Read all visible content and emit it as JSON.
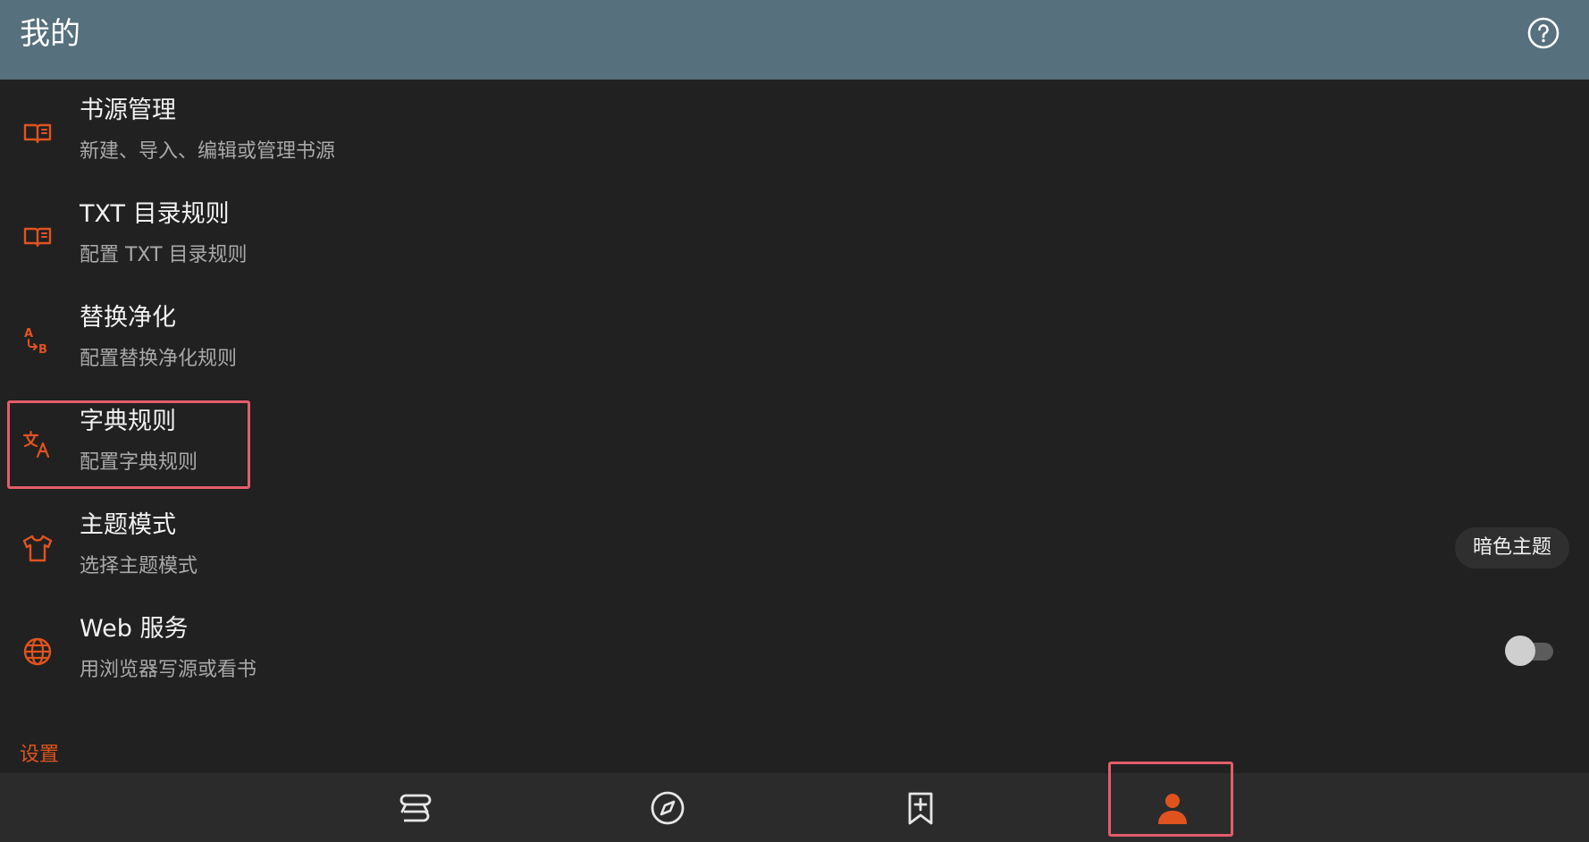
{
  "appbar": {
    "title": "我的",
    "help_icon": "help-circle-icon"
  },
  "menu": [
    {
      "title": "书源管理",
      "subtitle": "新建、导入、编辑或管理书源",
      "icon": "book-open-icon"
    },
    {
      "title": "TXT 目录规则",
      "subtitle": "配置 TXT 目录规则",
      "icon": "book-open-icon"
    },
    {
      "title": "替换净化",
      "subtitle": "配置替换净化规则",
      "icon": "a-to-b-replace-icon"
    },
    {
      "title": "字典规则",
      "subtitle": "配置字典规则",
      "icon": "translate-icon"
    },
    {
      "title": "主题模式",
      "subtitle": "选择主题模式",
      "icon": "tshirt-icon"
    },
    {
      "title": "Web 服务",
      "subtitle": "用浏览器写源或看书",
      "icon": "globe-icon"
    }
  ],
  "theme_chip": {
    "label": "暗色主题"
  },
  "web_service_switch": {
    "on": false
  },
  "section_settings": "设置",
  "bottom_nav": [
    {
      "name": "bookshelf",
      "icon": "bookshelf-icon",
      "active": false
    },
    {
      "name": "discover",
      "icon": "compass-icon",
      "active": false
    },
    {
      "name": "rss",
      "icon": "bookmark-plus-icon",
      "active": false
    },
    {
      "name": "my",
      "icon": "person-icon",
      "active": true
    }
  ],
  "colors": {
    "accent": "#E0531F",
    "appbar": "#56707D",
    "background": "#212121",
    "bottom_bar": "#2B2B2B",
    "highlight_box": "#E35D6A"
  }
}
